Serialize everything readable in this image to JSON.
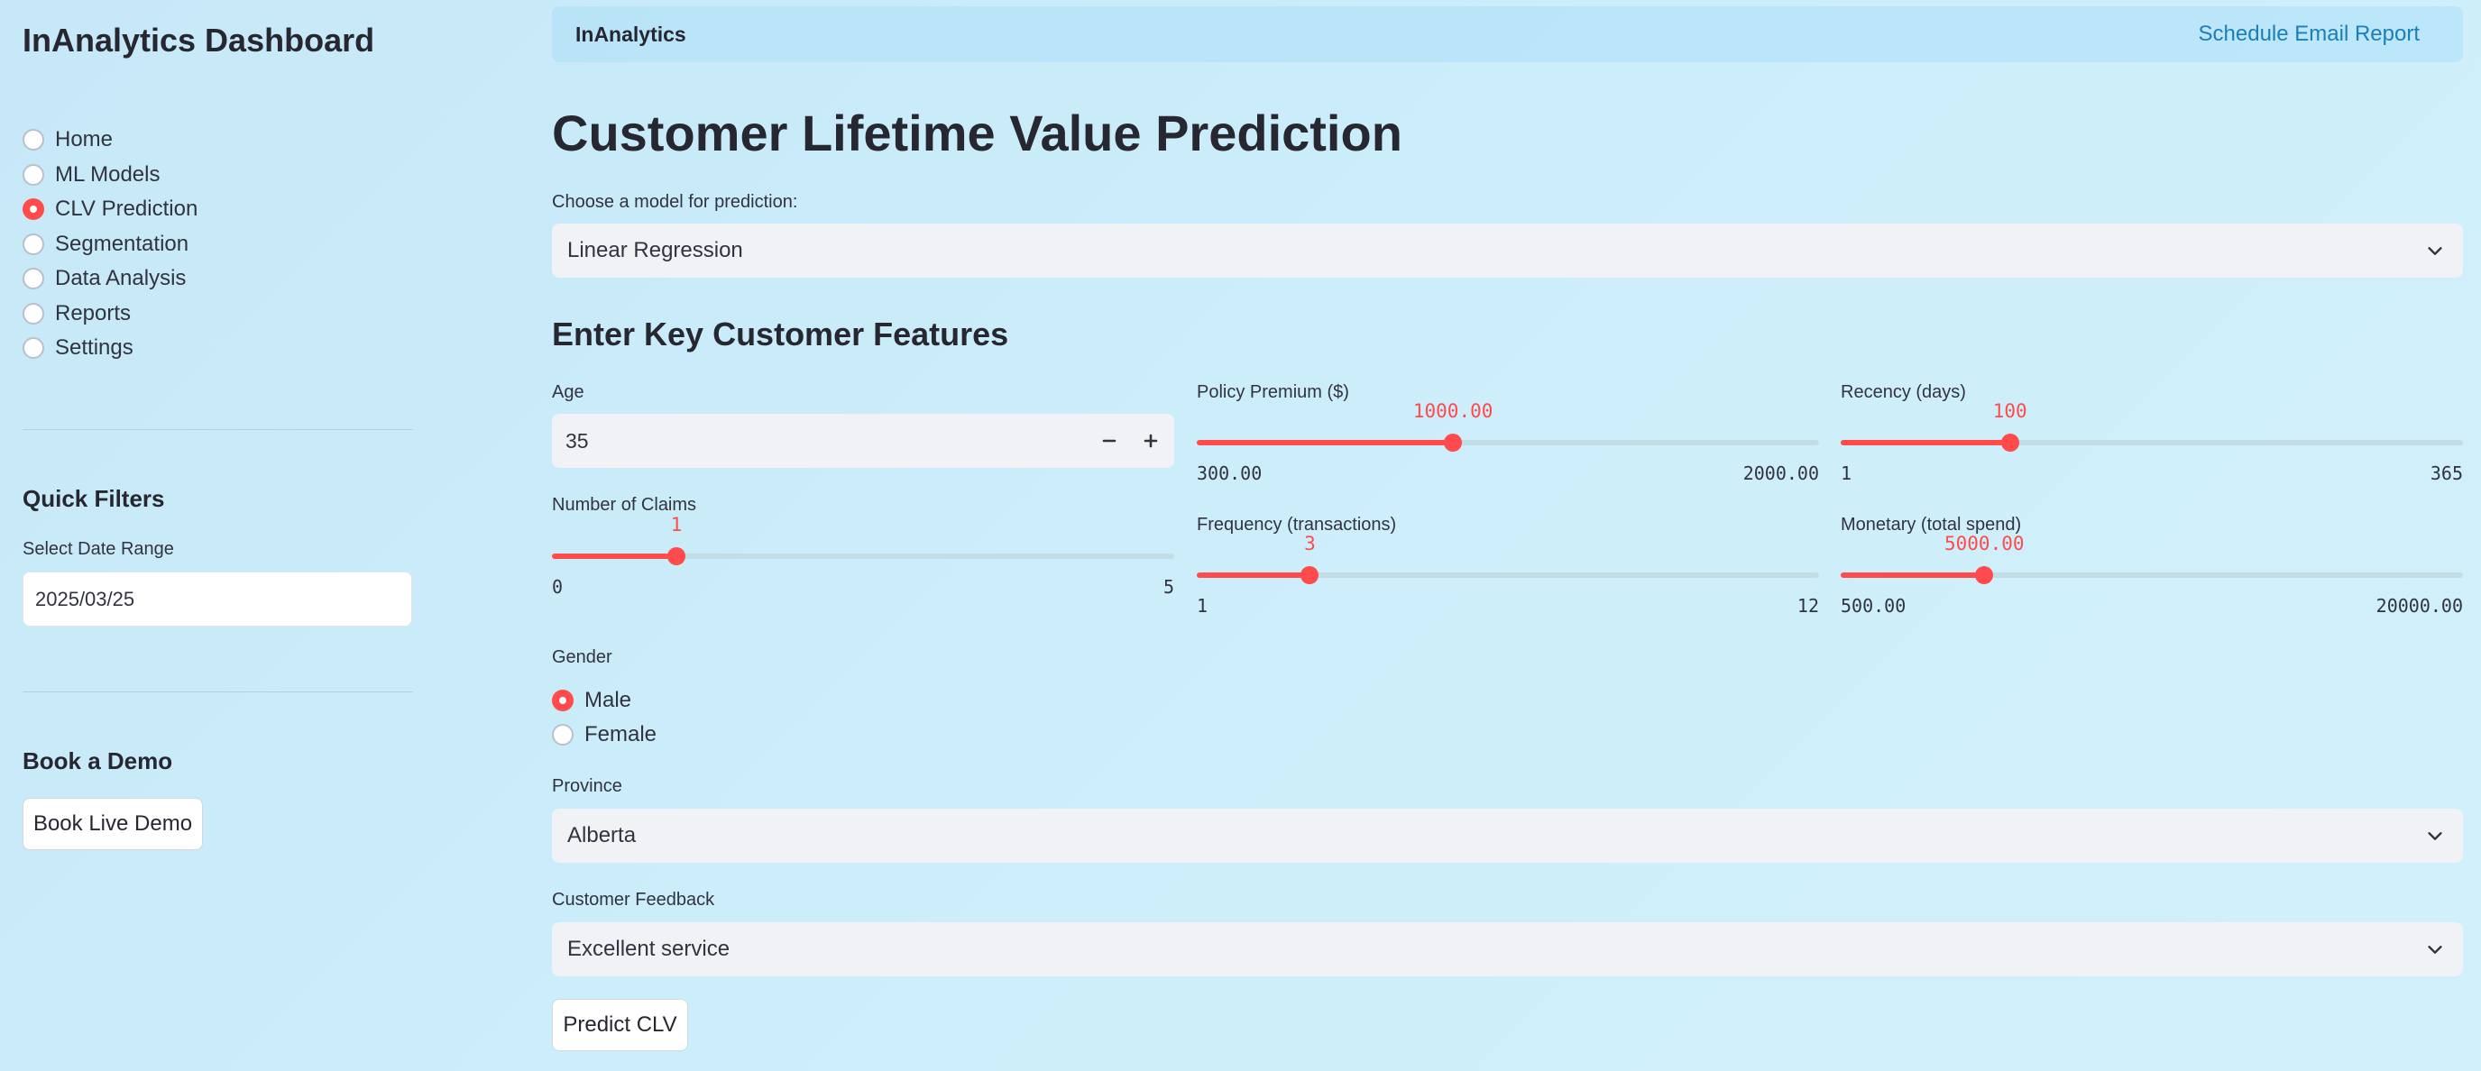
{
  "sidebar": {
    "app_title": "InAnalytics Dashboard",
    "nav": [
      {
        "label": "Home",
        "selected": false
      },
      {
        "label": "ML Models",
        "selected": false
      },
      {
        "label": "CLV Prediction",
        "selected": true
      },
      {
        "label": "Segmentation",
        "selected": false
      },
      {
        "label": "Data Analysis",
        "selected": false
      },
      {
        "label": "Reports",
        "selected": false
      },
      {
        "label": "Settings",
        "selected": false
      }
    ],
    "quick_filters_heading": "Quick Filters",
    "date_range_label": "Select Date Range",
    "date_range_value": "2025/03/25",
    "demo_heading": "Book a Demo",
    "demo_button": "Book Live Demo"
  },
  "topbar": {
    "brand": "InAnalytics",
    "email_link": "Schedule Email Report"
  },
  "main": {
    "title": "Customer Lifetime Value Prediction",
    "model_label": "Choose a model for prediction:",
    "model_value": "Linear Regression",
    "features_heading": "Enter Key Customer Features",
    "age": {
      "label": "Age",
      "value": "35",
      "minus": "−",
      "plus": "+"
    },
    "sliders": {
      "policy_premium": {
        "label": "Policy Premium ($)",
        "value": "1000.00",
        "min": "300.00",
        "max": "2000.00",
        "fraction": 0.4118
      },
      "recency": {
        "label": "Recency (days)",
        "value": "100",
        "min": "1",
        "max": "365",
        "fraction": 0.272
      },
      "num_claims": {
        "label": "Number of Claims",
        "value": "1",
        "min": "0",
        "max": "5",
        "fraction": 0.2
      },
      "frequency": {
        "label": "Frequency (transactions)",
        "value": "3",
        "min": "1",
        "max": "12",
        "fraction": 0.1818
      },
      "monetary": {
        "label": "Monetary (total spend)",
        "value": "5000.00",
        "min": "500.00",
        "max": "20000.00",
        "fraction": 0.2308
      }
    },
    "gender": {
      "label": "Gender",
      "options": [
        {
          "label": "Male",
          "selected": true
        },
        {
          "label": "Female",
          "selected": false
        }
      ]
    },
    "province": {
      "label": "Province",
      "value": "Alberta"
    },
    "feedback": {
      "label": "Customer Feedback",
      "value": "Excellent service"
    },
    "predict_button": "Predict CLV"
  },
  "colors": {
    "accent": "#ff4b4b",
    "link": "#1a7fb8",
    "input_bg": "#f0f2f6"
  },
  "icons": [
    "chevron-down-icon",
    "minus-icon",
    "plus-icon",
    "radio-icon"
  ]
}
